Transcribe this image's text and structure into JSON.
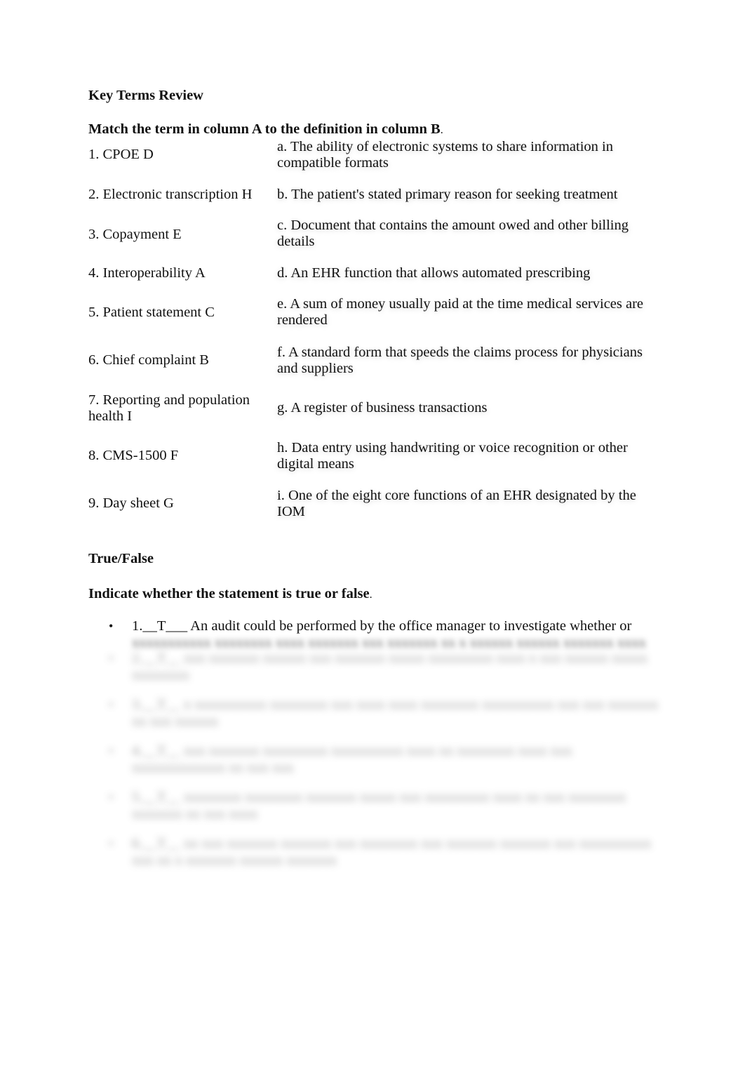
{
  "document": {
    "section1_title": "Key Terms Review",
    "section1_instruction": "Match the term in column A to the definition in column B",
    "section1_instruction_tail": ".",
    "matching": [
      {
        "term": "1. CPOE D",
        "definition": "a. The ability of electronic systems to share information in compatible formats"
      },
      {
        "term": "2. Electronic transcription H",
        "definition": "b. The patient's stated primary reason for seeking treatment"
      },
      {
        "term": "3. Copayment E",
        "definition": "c. Document that contains the amount owed and other billing details"
      },
      {
        "term": "4. Interoperability A",
        "definition": "d. An EHR function that allows automated prescribing"
      },
      {
        "term": "5. Patient statement C",
        "definition": "e. A sum of money usually paid at the time medical services are rendered"
      },
      {
        "term": "6. Chief complaint B",
        "definition": "f. A standard form that speeds the claims process for physicians and suppliers"
      },
      {
        "term": "7. Reporting and population health I",
        "definition": "g. A register of business transactions"
      },
      {
        "term": "8. CMS-1500 F",
        "definition": "h. Data entry using handwriting or voice recognition or other digital means"
      },
      {
        "term": "9. Day sheet G",
        "definition": "i. One of the eight core functions of an EHR designated by the IOM"
      }
    ],
    "section2_title": "True/False",
    "section2_instruction": "Indicate whether the statement is true or false",
    "section2_instruction_tail": ".",
    "true_false": [
      {
        "visible": "1.__T___ An audit could be performed by the office manager to investigate whether or",
        "obscured": "xxxxxxxxxxx xxxxxxxx xxxx xxxxxxx xxx xxxxxxx xx x xxxxxx xxxxxx xxxxxxx xxxx"
      },
      {
        "obscured": "2.__T__ xxx xxxxxxx xxxxxx xxx xxxxxxx xxxxx xxxxxxxxx xxxx x xxx xxxxxx xxxxx xxxxxxxx"
      },
      {
        "obscured": "3.__T__ x xxxxxxxxxx xxxxxxxx xxx xxxx xxxx xxxxxxxx xxxxxxxxxx xxx xxx xxxxxxx xx xxx xxxxxx"
      },
      {
        "obscured": "4.__T__ xxx xxxxxxx xxxxxxxxx xxxxxxxxxx xxxx xx xxxxxxxx xxxx xxx xxxxxxxxxxxxx xx xxx xxx"
      },
      {
        "obscured": "5.__T__ xxxxxxxx xxxxxxxx xxxxxxx xxxxx xxx xxxxxxxxx xxxx xx xxx xxxxxxxx xxxxxxx xx xxx xxxx"
      },
      {
        "obscured": "6.__T__ xx xxx xxxxxxx xxxxxxx xxx xxxxxxxx xxx xxxxxxx xxxxxxx xxx xxxxxxxxxx xxx xx x xxxxxxx xxxxxx xxxxxxx"
      }
    ],
    "bullet_glyph": "•"
  }
}
